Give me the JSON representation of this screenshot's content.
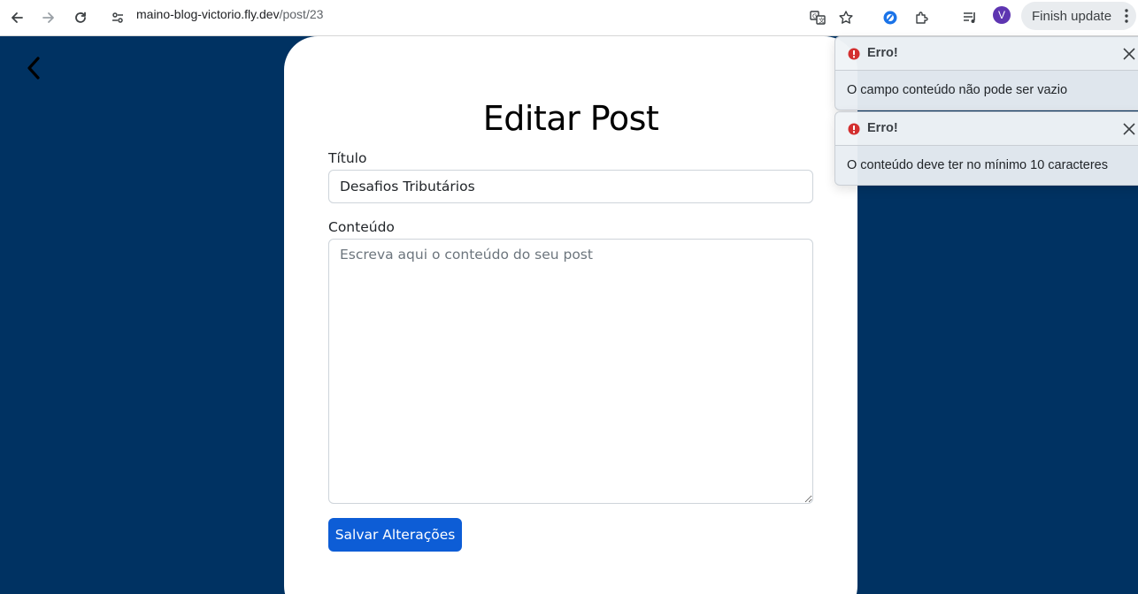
{
  "browser": {
    "url_host": "maino-blog-victorio.fly.dev",
    "url_path": "/post/23",
    "profile_initial": "V",
    "finish_update_label": "Finish update"
  },
  "page": {
    "heading": "Editar Post",
    "title_label": "Título",
    "title_value": "Desafios Tributários",
    "content_label": "Conteúdo",
    "content_value": "",
    "content_placeholder": "Escreva aqui o conteúdo do seu post",
    "save_label": "Salvar Alterações"
  },
  "toasts": [
    {
      "title": "Erro!",
      "message": "O campo conteúdo não pode ser vazio"
    },
    {
      "title": "Erro!",
      "message": "O conteúdo deve ter no mínimo 10 caracteres"
    }
  ],
  "colors": {
    "page_background": "#003262",
    "primary_button": "#0d5dd6",
    "error_icon": "#d32f2f"
  }
}
